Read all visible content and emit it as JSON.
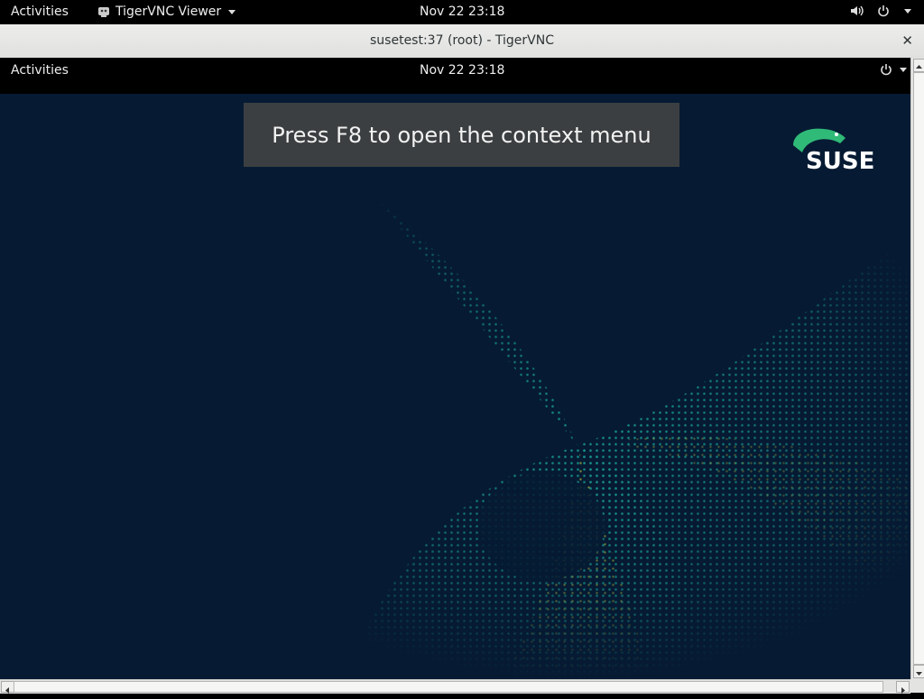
{
  "host_topbar": {
    "activities": "Activities",
    "app_name": "TigerVNC Viewer",
    "clock": "Nov 22  23:18",
    "icons": [
      "volume-icon",
      "power-icon",
      "chevron-down-icon"
    ]
  },
  "window": {
    "title": "susetest:37 (root) - TigerVNC",
    "close_glyph": "✕"
  },
  "remote": {
    "topbar": {
      "activities": "Activities",
      "clock": "Nov 22  23:18"
    },
    "notice": "Press F8 to open the context menu",
    "logo_text": "SUSE",
    "colors": {
      "wallpaper": "#061b33",
      "swirl_teal": "#1aa59a",
      "swirl_yellow": "#c8d23c",
      "suse_green": "#30ba78"
    }
  }
}
